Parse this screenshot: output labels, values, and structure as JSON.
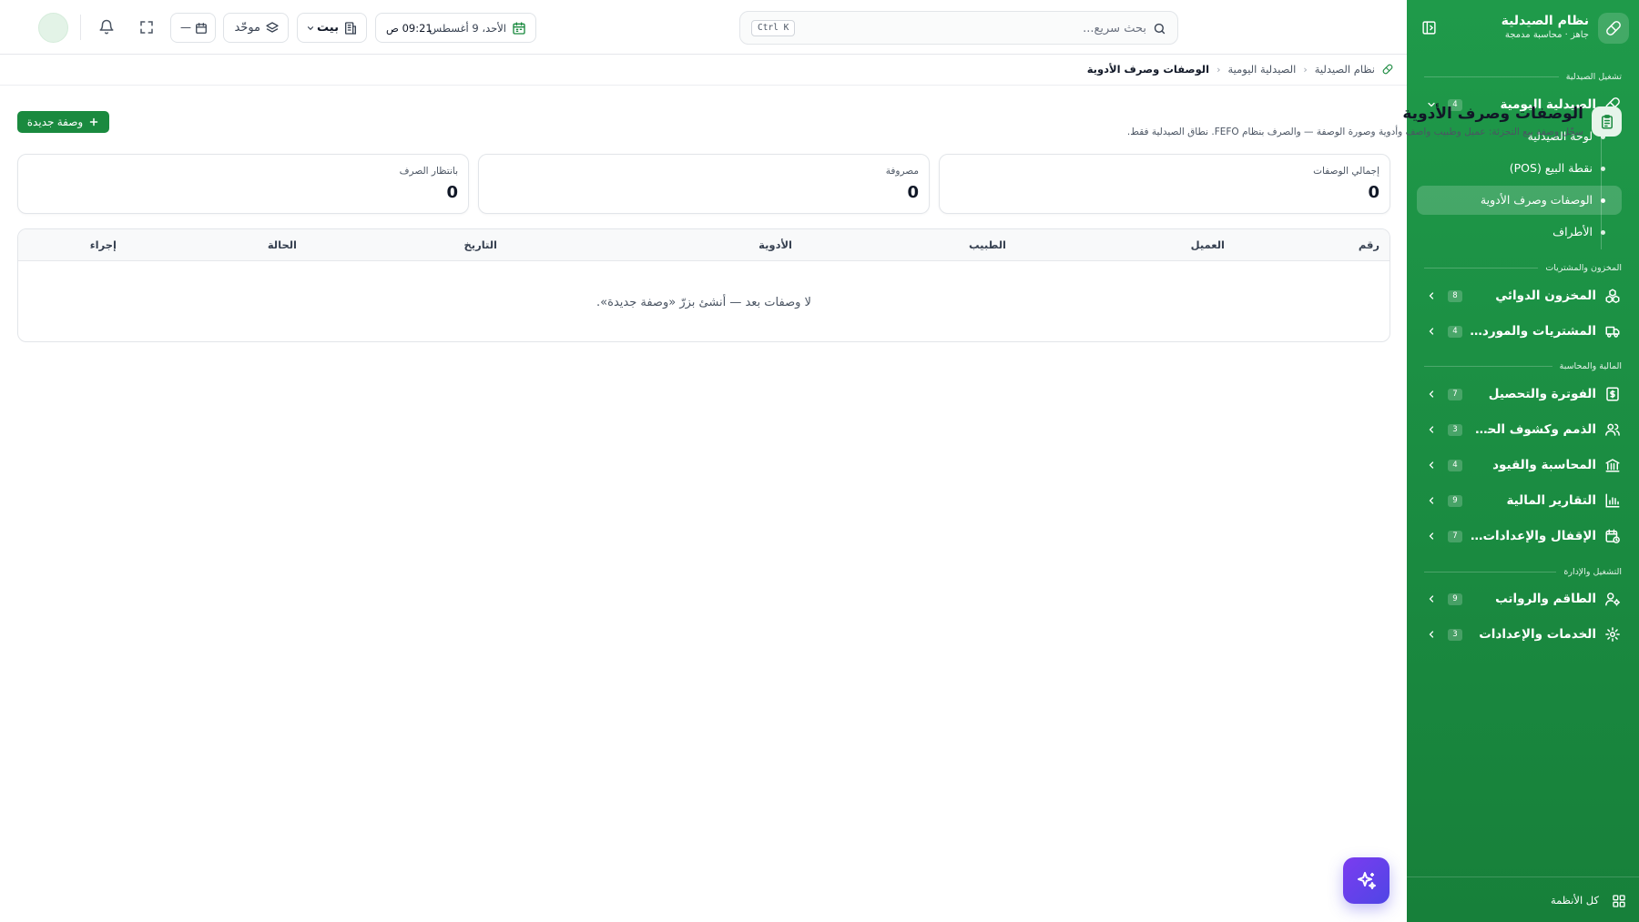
{
  "sidebar": {
    "brand_title": "نظام الصيدلية",
    "brand_subtitle": "جاهز · محاسبة مدمجة",
    "sections": {
      "pharmacy_ops": "تشغيل الصيدلية",
      "inventory_purchases": "المخزون والمشتريات",
      "finance_accounting": "المالية والمحاسبة",
      "operations_admin": "التشغيل والإدارة"
    },
    "items": {
      "daily_pharmacy": {
        "label": "الصيدلية اليومية",
        "count": "4"
      },
      "drug_inventory": {
        "label": "المخزون الدوائي",
        "count": "8"
      },
      "purchases_suppliers": {
        "label": "المشتريات والموردون",
        "count": "4"
      },
      "billing_collection": {
        "label": "الفوترة والتحصيل",
        "count": "7"
      },
      "receivables_statements": {
        "label": "الذمم وكشوف الحساب",
        "count": "3"
      },
      "accounting_entries": {
        "label": "المحاسبة والقيود",
        "count": "4"
      },
      "financial_reports": {
        "label": "التقارير المالية",
        "count": "9"
      },
      "closing_settings": {
        "label": "الإقفال والإعدادات الم...",
        "count": "7"
      },
      "staff_payroll": {
        "label": "الطاقم والرواتب",
        "count": "9"
      },
      "services_settings": {
        "label": "الخدمات والإعدادات",
        "count": "3"
      }
    },
    "sub_items": {
      "dashboard": "لوحة الصيدلية",
      "pos": "نقطة البيع (POS)",
      "prescriptions": "الوصفات وصرف الأدوية",
      "parties": "الأطراف"
    },
    "footer_label": "كل الأنظمة"
  },
  "topbar": {
    "search_placeholder": "بحث سريع...",
    "search_shortcut": "Ctrl K",
    "date_text": "الأحد، 9 أغسطس",
    "time_text": "09:21 ص",
    "branch_label": "بيت",
    "unified_label": "موحّد",
    "calendar_mini_label": "—"
  },
  "breadcrumb": {
    "root": "نظام الصيدلية",
    "parent": "الصيدلية اليومية",
    "current": "الوصفات وصرف الأدوية"
  },
  "page": {
    "title": "الوصفات وصرف الأدوية",
    "description": "سجّل وصفة بيع التجزئة: عميل وطبيب واصف وأدوية وصورة الوصفة — والصرف بنظام FEFO. نطاق الصيدلية فقط.",
    "new_button_label": "وصفة جديدة"
  },
  "stats": {
    "total": {
      "label": "إجمالي الوصفات",
      "value": "0"
    },
    "dispensed": {
      "label": "مصروفة",
      "value": "0"
    },
    "pending": {
      "label": "بانتظار الصرف",
      "value": "0"
    }
  },
  "table": {
    "columns": {
      "number": "رقم",
      "customer": "العميل",
      "doctor": "الطبيب",
      "medicines": "الأدوية",
      "date": "التاريخ",
      "status": "الحالة",
      "action": "إجراء"
    },
    "empty_message": "لا وصفات بعد — أنشئ بزرّ «وصفة جديدة»."
  },
  "colors": {
    "sidebar_green": "#1f9a4a",
    "primary_button": "#1a8a3f",
    "fab_purple": "#6d3ef0"
  }
}
